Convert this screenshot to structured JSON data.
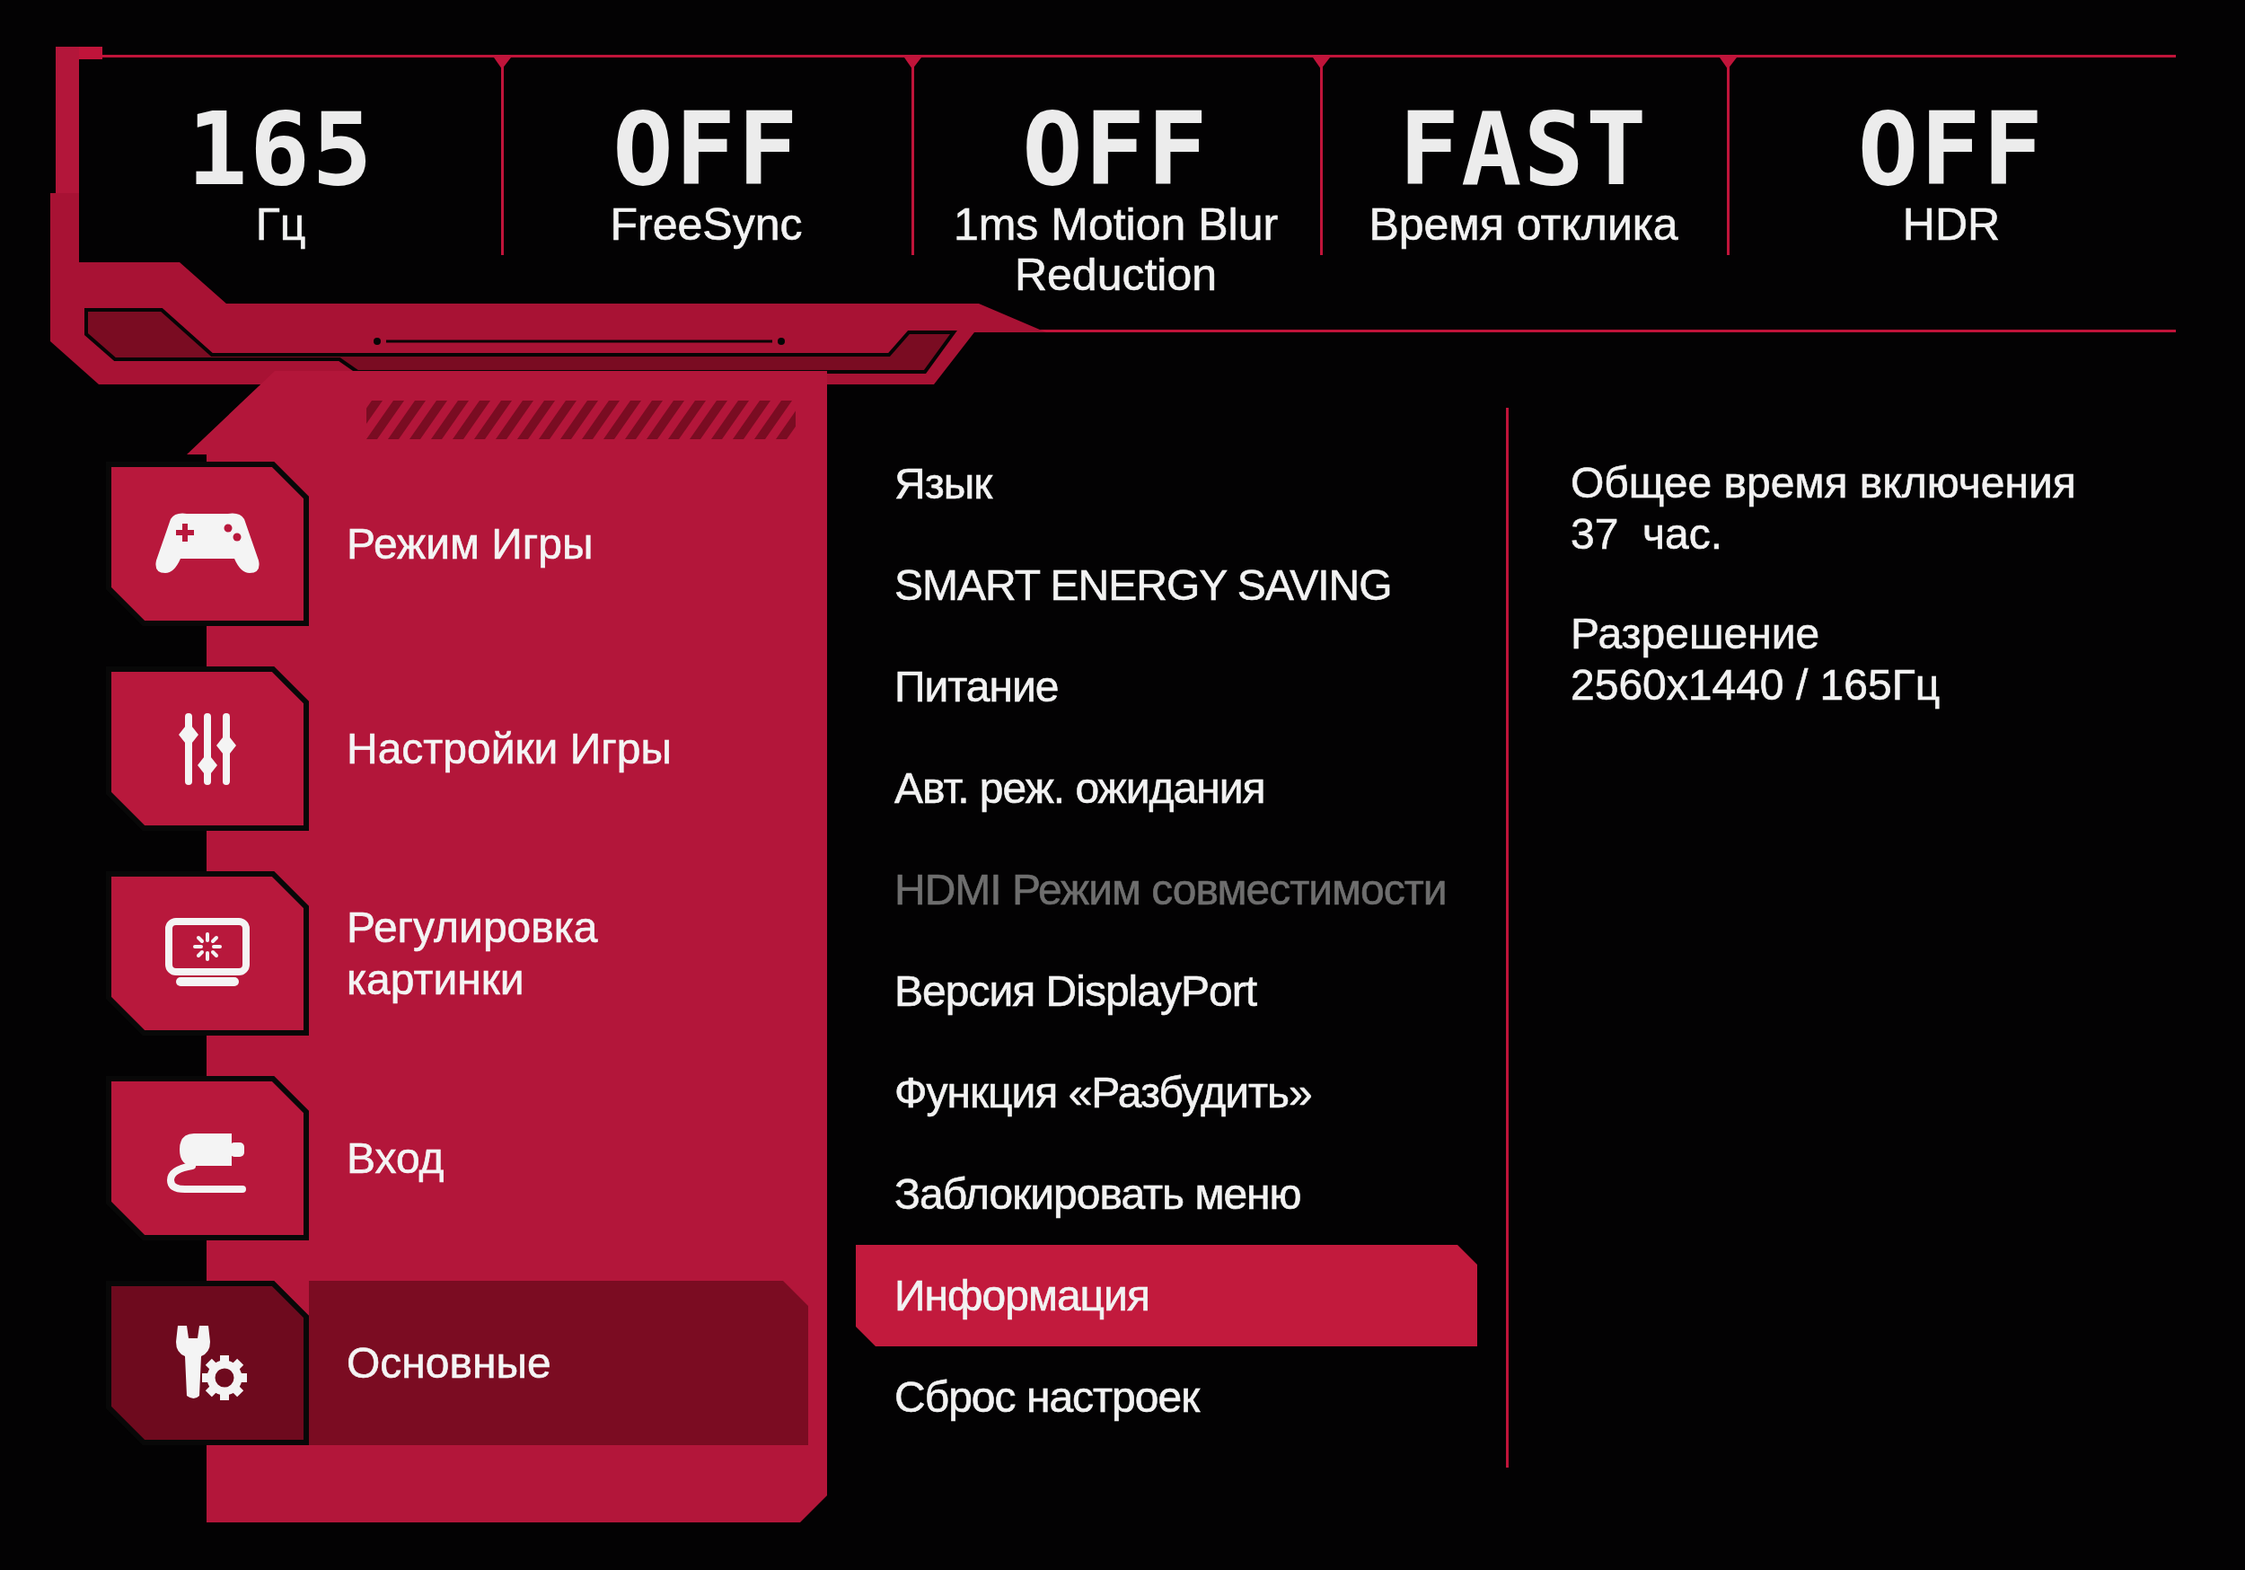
{
  "status_bar": {
    "items": [
      {
        "value": "165",
        "label": "Гц"
      },
      {
        "value": "OFF",
        "label": "FreeSync"
      },
      {
        "value": "OFF",
        "label": "1ms Motion Blur Reduction"
      },
      {
        "value": "FAST",
        "label": "Время отклика"
      },
      {
        "value": "OFF",
        "label": "HDR"
      }
    ]
  },
  "sidebar": {
    "items": [
      {
        "label": "Режим Игры",
        "selected": false
      },
      {
        "label": "Настройки Игры",
        "selected": false
      },
      {
        "label": "Регулировка картинки",
        "selected": false
      },
      {
        "label": "Вход",
        "selected": false
      },
      {
        "label": "Основные",
        "selected": true
      }
    ]
  },
  "menu": {
    "items": [
      {
        "label": "Язык",
        "selected": false,
        "disabled": false
      },
      {
        "label": "SMART ENERGY SAVING",
        "selected": false,
        "disabled": false
      },
      {
        "label": "Питание",
        "selected": false,
        "disabled": false
      },
      {
        "label": "Авт. реж. ожидания",
        "selected": false,
        "disabled": false
      },
      {
        "label": "HDMI Режим совместимости",
        "selected": false,
        "disabled": true
      },
      {
        "label": "Версия DisplayPort",
        "selected": false,
        "disabled": false
      },
      {
        "label": "Функция «Разбудить»",
        "selected": false,
        "disabled": false
      },
      {
        "label": "Заблокировать меню",
        "selected": false,
        "disabled": false
      },
      {
        "label": "Информация",
        "selected": true,
        "disabled": false
      },
      {
        "label": "Сброс настроек",
        "selected": false,
        "disabled": false
      }
    ]
  },
  "info": {
    "items": [
      {
        "label": "Общее время включения",
        "value": "37  час."
      },
      {
        "label": "Разрешение",
        "value": "2560x1440 / 165Гц"
      }
    ]
  }
}
